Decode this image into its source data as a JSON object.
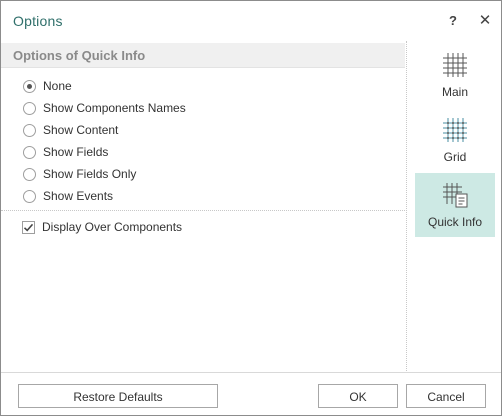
{
  "dialog": {
    "title": "Options",
    "help_label": "?",
    "close_label": "✕"
  },
  "quick_info": {
    "section_title": "Options of Quick Info",
    "options": [
      {
        "label": "None",
        "selected": true
      },
      {
        "label": "Show Components Names",
        "selected": false
      },
      {
        "label": "Show Content",
        "selected": false
      },
      {
        "label": "Show Fields",
        "selected": false
      },
      {
        "label": "Show Fields Only",
        "selected": false
      },
      {
        "label": "Show Events",
        "selected": false
      }
    ],
    "display_over_components": {
      "label": "Display Over Components",
      "checked": true
    }
  },
  "nav": {
    "items": [
      {
        "label": "Main",
        "icon": "grid-icon",
        "active": false
      },
      {
        "label": "Grid",
        "icon": "grid-dotted-icon",
        "active": false
      },
      {
        "label": "Quick Info",
        "icon": "grid-document-icon",
        "active": true
      }
    ]
  },
  "buttons": {
    "restore": "Restore Defaults",
    "ok": "OK",
    "cancel": "Cancel"
  },
  "colors": {
    "title": "#2f6f6a",
    "active_nav_bg": "#cde9e4",
    "section_header_bg": "#f0f0f0"
  }
}
